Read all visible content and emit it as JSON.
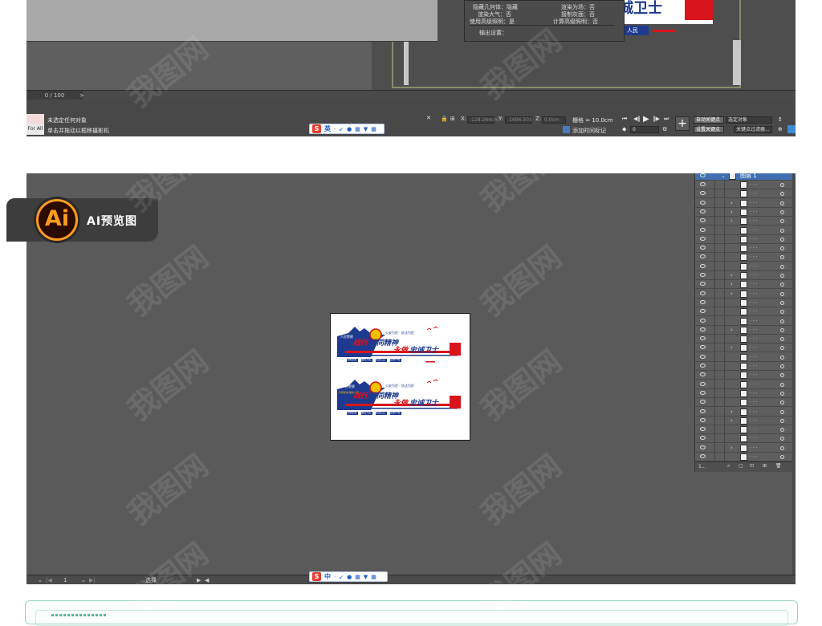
{
  "max_window": {
    "timeline_counter": "0 / 100",
    "timeline_arrow": ">",
    "props_panel": {
      "row1_left": "隐藏几何体：隐藏",
      "row1_right": "渲染为场：否",
      "row2_left": "渲染大气：否",
      "row2_right": "接制灰面：否",
      "row3_left": "使用高级照明：是",
      "row3_right": "计算高级照明：否",
      "output_label": "输出设置："
    },
    "poster_text": "诚卫士",
    "poster_small": "人民",
    "status": {
      "forall": "For All",
      "line1": "未选定任何对象",
      "line2": "单击并拖动以框移摄影机"
    },
    "coords": {
      "x_label": "X:",
      "x_value": "-128.264cm",
      "y_label": "Y:",
      "y_value": "-1696.503",
      "z_label": "Z:",
      "z_value": "0.0cm"
    },
    "grid_text": "栅格 = 10.0cm",
    "add_timetag": "添加时间标记",
    "frame_value": "0",
    "auto_key": "自动关键点",
    "set_key": "设置关键点",
    "selected_object": "选定对象",
    "key_filter": "关键点过滤器..."
  },
  "ime_top": {
    "logo": "S",
    "mode": "英",
    "icons": [
      "·",
      "↙",
      "🎤",
      "▦",
      "👕",
      "▦"
    ]
  },
  "ime_bottom": {
    "logo": "S",
    "mode": "中",
    "icons": [
      "·",
      "↙",
      "🎤",
      "▦",
      "👕",
      "▦"
    ]
  },
  "badge": {
    "logo": "Ai",
    "label": "AI预览图"
  },
  "ai_window": {
    "layer_name": "图层 1",
    "layer_count": "1...",
    "bottom_bar": {
      "zoom": "1",
      "tool": "选择",
      "arrow_left": "◀",
      "arrow_right": "▶"
    }
  },
  "poster1": {
    "badge_line": "人民警察",
    "headline_a": "践行",
    "headline_b": "调同精神",
    "headline_c": "永做",
    "headline_d": "忠诚卫士",
    "small_line": "公安为民 · 执法为民",
    "tags": [
      "对党忠诚",
      "服务人民",
      "执法公正",
      "纪律严明"
    ]
  },
  "poster2": {
    "badge_line": "人民警察",
    "sub_line": "对党忠诚 服务人民",
    "headline_a": "践行",
    "headline_b": "调同精神",
    "headline_c": "永做",
    "headline_d": "忠诚卫士",
    "small_line": "公安为民 · 执法为民",
    "tags": [
      "对党忠诚",
      "服务人民",
      "执法公正",
      "纪律严明"
    ]
  },
  "colors": {
    "navy": "#1d3a8f",
    "red": "#d9141b",
    "ai_orange": "#ff9a1f",
    "frame_teal": "#9ad4c4"
  }
}
